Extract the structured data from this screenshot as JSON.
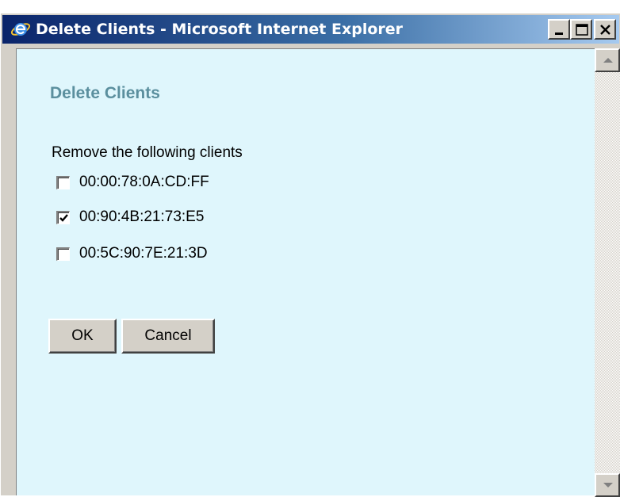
{
  "window": {
    "title": "Delete Clients - Microsoft Internet Explorer",
    "icon": "internet-explorer-icon",
    "controls": [
      "minimize-icon",
      "maximize-icon",
      "close-icon"
    ]
  },
  "page": {
    "heading": "Delete Clients",
    "instruction": "Remove the following clients",
    "clients": [
      {
        "mac": "00:00:78:0A:CD:FF",
        "checked": false
      },
      {
        "mac": "00:90:4B:21:73:E5",
        "checked": true
      },
      {
        "mac": "00:5C:90:7E:21:3D",
        "checked": false
      }
    ],
    "buttons": {
      "ok": "OK",
      "cancel": "Cancel"
    }
  },
  "colors": {
    "page_background": "#dff6fc",
    "heading": "#5b8f9e",
    "titlebar_start": "#0a246a",
    "titlebar_end": "#a6caf0"
  }
}
